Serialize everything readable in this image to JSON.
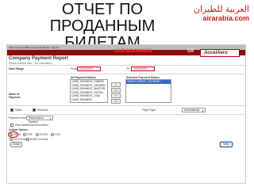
{
  "slide": {
    "title": "ОТЧЕТ ПО ПРОДАННЫМ БИЛЕТАМ"
  },
  "brand": {
    "arabic": "العربية للطيران",
    "name": "airarabia.com"
  },
  "app": {
    "menu": [
      "Make Reservation",
      "Find Reservation",
      "Flights",
      "System"
    ],
    "live_label": "LIVE BOOKINGS",
    "g9": "G9",
    "product": "AccelAero",
    "page_title": "Company Payment Report",
    "required_note": "Fields marked with * are mandatory",
    "date_range": {
      "label": "Date Range",
      "from_label": "From",
      "from_value": "01/02/2013",
      "to_label": "To",
      "to_value": "19/02/2013"
    },
    "payment": {
      "label": "Mode of Payment",
      "all_title": "All Payment Modes",
      "selected_title": "Selected Payment Modes",
      "all_modes": [
        "CARD_PAYMENT_DINERS",
        "CARD_PAYMENT_GENERIC",
        "CARD_PAYMENT_MASTER",
        "CARD_PAYMENT_PAYPAL",
        "CARD_PAYMENT_VISA",
        "CASH_PAYMENT"
      ],
      "selected_modes": [
        "TRAVELCREDIT_PAYMENT"
      ],
      "buttons": {
        "add": ">",
        "add_all": ">>",
        "remove": "<",
        "remove_all": "<<"
      }
    },
    "flags": {
      "sales": "Sales",
      "refunds": "Refunds"
    },
    "flight_type": {
      "label": "Flight Type",
      "value": "International"
    },
    "payment_source": {
      "label": "Payment Source",
      "value": "Reservation System"
    },
    "additional": "Print Additional Information",
    "output": {
      "label": "Output Option",
      "formats": [
        "HTML",
        "PDF",
        "EXCEL",
        "CSV"
      ],
      "selected_format": "HTML",
      "currency_options": [
        "US Format",
        "EURO Format"
      ],
      "selected_currency": "EURO Format"
    },
    "buttons": {
      "close": "Close",
      "view": "View"
    }
  }
}
